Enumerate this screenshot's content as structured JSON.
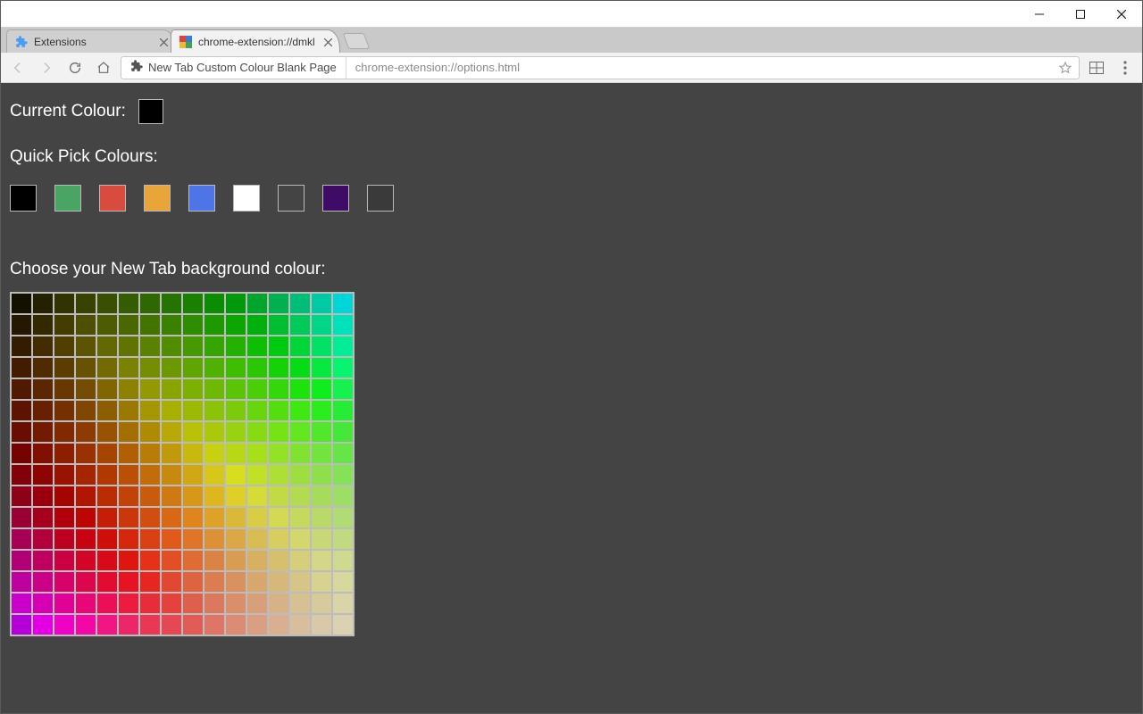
{
  "window": {
    "controls": {
      "min": true,
      "max": true,
      "close": true
    }
  },
  "tabs": [
    {
      "title": "Extensions",
      "active": false,
      "icon": "puzzle"
    },
    {
      "title": "chrome-extension://dmkl",
      "active": true,
      "icon": "color-grid"
    }
  ],
  "toolbar": {
    "chip_icon": "puzzle",
    "chip_text": "New Tab Custom Colour Blank Page",
    "url_text": "chrome-extension://options.html"
  },
  "page": {
    "current_label": "Current Colour:",
    "current_colour": "#000000",
    "quick_label": "Quick Pick Colours:",
    "quick_colours": [
      "#000000",
      "#4aa564",
      "#d94a3f",
      "#e8a63a",
      "#4e74e6",
      "#ffffff",
      "#444444",
      "#3e0b66",
      "#3a3a3a"
    ],
    "choose_label": "Choose your New Tab background colour:",
    "grid_rows": 16,
    "grid_cols": 16
  }
}
